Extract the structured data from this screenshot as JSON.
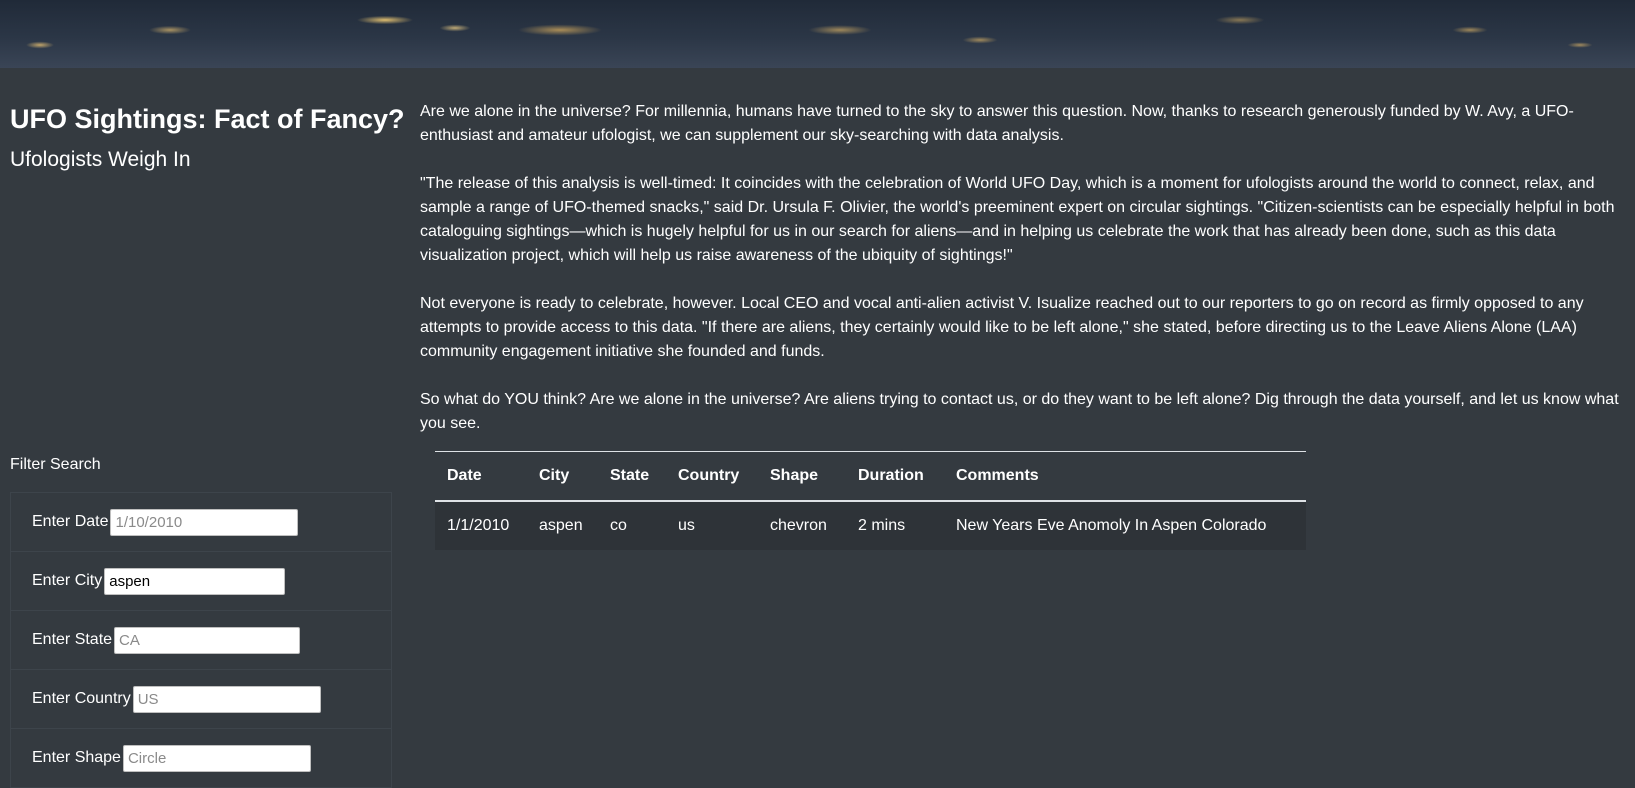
{
  "header": {
    "title": "UFO Sightings: Fact of Fancy?",
    "subtitle": "Ufologists Weigh In"
  },
  "article": {
    "paragraphs": [
      "Are we alone in the universe? For millennia, humans have turned to the sky to answer this question. Now, thanks to research generously funded by W. Avy, a UFO-enthusiast and amateur ufologist, we can supplement our sky-searching with data analysis.",
      "\"The release of this analysis is well-timed: It coincides with the celebration of World UFO Day, which is a moment for ufologists around the world to connect, relax, and sample a range of UFO-themed snacks,\" said Dr. Ursula F. Olivier, the world's preeminent expert on circular sightings. \"Citizen-scientists can be especially helpful in both cataloguing sightings—which is hugely helpful for us in our search for aliens—and in helping us celebrate the work that has already been done, such as this data visualization project, which will help us raise awareness of the ubiquity of sightings!\"",
      "Not everyone is ready to celebrate, however. Local CEO and vocal anti-alien activist V. Isualize reached out to our reporters to go on record as firmly opposed to any attempts to provide access to this data. \"If there are aliens, they certainly would like to be left alone,\" she stated, before directing us to the Leave Aliens Alone (LAA) community engagement initiative she founded and funds.",
      "So what do YOU think? Are we alone in the universe? Are aliens trying to contact us, or do they want to be left alone? Dig through the data yourself, and let us know what you see."
    ]
  },
  "filters": {
    "heading": "Filter Search",
    "items": [
      {
        "label": "Enter Date",
        "value": "",
        "placeholder": "1/10/2010"
      },
      {
        "label": "Enter City",
        "value": "aspen",
        "placeholder": ""
      },
      {
        "label": "Enter State",
        "value": "",
        "placeholder": "CA"
      },
      {
        "label": "Enter Country",
        "value": "",
        "placeholder": "US"
      },
      {
        "label": "Enter Shape",
        "value": "",
        "placeholder": "Circle"
      }
    ]
  },
  "table": {
    "headers": [
      "Date",
      "City",
      "State",
      "Country",
      "Shape",
      "Duration",
      "Comments"
    ],
    "rows": [
      [
        "1/1/2010",
        "aspen",
        "co",
        "us",
        "chevron",
        "2 mins",
        "New Years Eve Anomoly In Aspen Colorado"
      ]
    ]
  },
  "colors": {
    "background": "#343a40",
    "row_background": "#2e3338",
    "text": "#ffffff"
  }
}
